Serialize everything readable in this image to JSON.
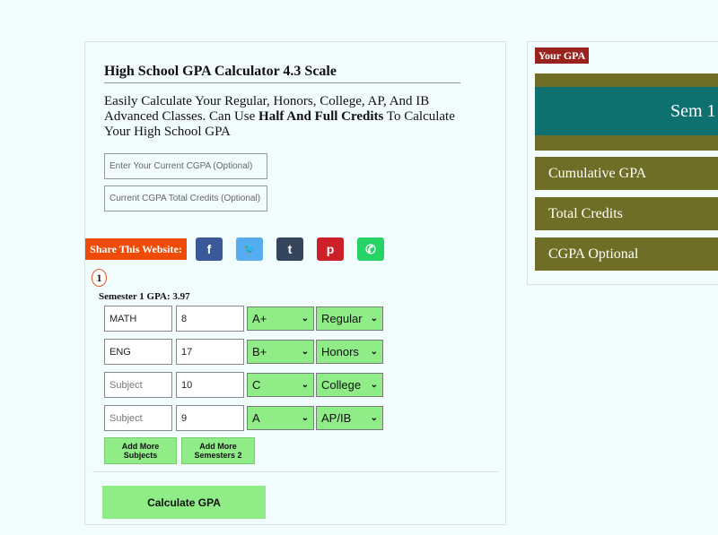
{
  "calculator": {
    "title": "High School GPA Calculator 4.3 Scale",
    "description_pre": "Easily Calculate Your Regular, Honors, College, AP, And IB Advanced Classes. Can Use ",
    "description_bold": "Half And Full Credits",
    "description_post": " To Calculate Your High School GPA",
    "cgpa_placeholder": "Enter Your Current CGPA (Optional)",
    "credits_placeholder": "Current CGPA Total Credits (Optional)"
  },
  "share": {
    "label": "Share This Website:",
    "icons": [
      {
        "name": "facebook-icon",
        "glyph": "f",
        "color": "#3b5998"
      },
      {
        "name": "twitter-icon",
        "glyph": "🐦",
        "color": "#55acee"
      },
      {
        "name": "tumblr-icon",
        "glyph": "t",
        "color": "#35465c"
      },
      {
        "name": "pinterest-icon",
        "glyph": "p",
        "color": "#cb2027"
      },
      {
        "name": "whatsapp-icon",
        "glyph": "✆",
        "color": "#25d366"
      }
    ]
  },
  "semester": {
    "number": "1",
    "gpa_label": "Semester 1 GPA: 3.97",
    "rows": [
      {
        "subject": "MATH",
        "subject_placeholder": "Subject",
        "credits": "8",
        "grade": "A+",
        "type": "Regular"
      },
      {
        "subject": "ENG",
        "subject_placeholder": "Subject",
        "credits": "17",
        "grade": "B+",
        "type": "Honors"
      },
      {
        "subject": "",
        "subject_placeholder": "Subject",
        "credits": "10",
        "grade": "C",
        "type": "College"
      },
      {
        "subject": "",
        "subject_placeholder": "Subject",
        "credits": "9",
        "grade": "A",
        "type": "AP/IB"
      }
    ],
    "add_subjects_label": "Add More Subjects",
    "add_semesters_label": "Add More Semesters 2"
  },
  "calculate_label": "Calculate GPA",
  "results": {
    "badge": "Your GPA",
    "sem_label": "Sem 1",
    "cumulative_label": "Cumulative GPA",
    "total_credits_label": "Total Credits",
    "cgpa_optional_label": "CGPA Optional"
  },
  "colors": {
    "accent_green": "#8fec86",
    "share_orange": "#ee4b08",
    "gpa_red": "#98221e",
    "olive": "#6e6e26",
    "teal": "#0e706f"
  }
}
